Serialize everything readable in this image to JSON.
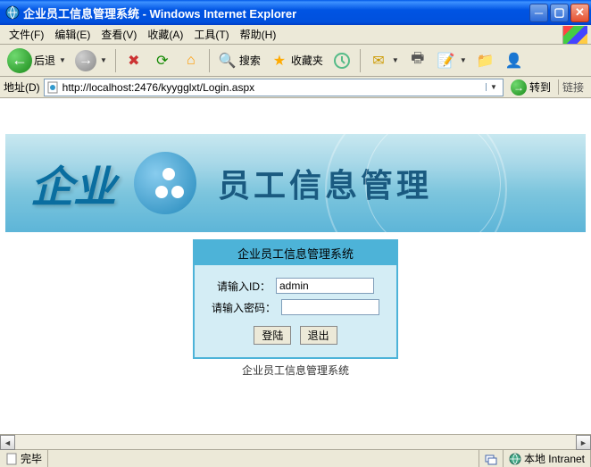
{
  "window": {
    "title": "企业员工信息管理系统 - Windows Internet Explorer"
  },
  "menu": {
    "file": "文件(F)",
    "edit": "编辑(E)",
    "view": "查看(V)",
    "favorites": "收藏(A)",
    "tools": "工具(T)",
    "help": "帮助(H)"
  },
  "toolbar": {
    "back": "后退",
    "search": "搜索",
    "favorites": "收藏夹"
  },
  "address": {
    "label": "地址(D)",
    "url": "http://localhost:2476/kyygglxt/Login.aspx",
    "go": "转到",
    "links": "链接"
  },
  "banner": {
    "logo_text": "企业",
    "main_title": "员工信息管理"
  },
  "login": {
    "header": "企业员工信息管理系统",
    "id_label": "请输入ID：",
    "id_value": "admin",
    "pwd_label": "请输入密码：",
    "pwd_value": "",
    "login_btn": "登陆",
    "exit_btn": "退出",
    "footer": "企业员工信息管理系统"
  },
  "status": {
    "done": "完毕",
    "zone": "本地 Intranet"
  }
}
